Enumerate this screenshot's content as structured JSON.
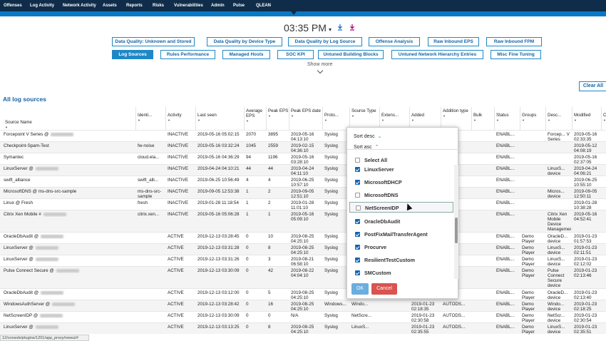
{
  "nav": {
    "items": [
      "Offenses",
      "Log Activity",
      "Network Activity",
      "Assets",
      "Reports",
      "Risks",
      "Vulnerabilities",
      "Admin",
      "Pulse",
      "QLEAN"
    ]
  },
  "clock": {
    "time": "03:35 PM",
    "chevron": "▾"
  },
  "icons": {
    "download_blue": "download-icon",
    "download_pink": "download-icon",
    "dropdown": "chevron-down-icon"
  },
  "tabs": {
    "row1": [
      "Data Quality: Unknown and Stored",
      "Data Quality by Device Type",
      "Data Quality by Log Source",
      "Offense Analysis",
      "Raw Inbound EPS",
      "Raw Inbound FPM"
    ],
    "row2": [
      "Log Sources",
      "Rules Performance",
      "Managed Hosts",
      "SOC KPI",
      "Untuned Building Blocks",
      "Untuned Network Hierarchy Entries",
      "Misc Fine Tuning"
    ],
    "active": "Log Sources",
    "show_more": "Show more"
  },
  "section": {
    "title": "All log sources",
    "clear_all": "Clear All"
  },
  "table": {
    "headers": [
      "Source Name",
      "Identi...",
      "Activity",
      "Last seen",
      "Average EPS",
      "Peak EPS",
      "Peak EPS date",
      "Proto...",
      "Source Type",
      "Extens...",
      "Added",
      "Addition type",
      "Bulk",
      "Status",
      "Groups",
      "Desc...",
      "Modified",
      "C"
    ],
    "rows": [
      {
        "name": "Forcepoint V Series @",
        "id": "",
        "act": "INACTIVE",
        "seen": "2019-05-16 05:02:15",
        "avg": "2070",
        "peak": "3895",
        "pdate": "2019-05-16 04:13:10",
        "proto": "Syslog",
        "status": "ENABL...",
        "groups": "",
        "desc": "Forcep... V Series",
        "mod": "2019-05-16 02:33:35"
      },
      {
        "name": "Checkpoint-Spam-Test",
        "id": "fw-noise",
        "act": "INACTIVE",
        "seen": "2019-05-16 03:32:24",
        "avg": "1045",
        "peak": "2559",
        "pdate": "2019-02-15 04:36:10",
        "proto": "Syslog",
        "status": "ENABL...",
        "groups": "",
        "desc": "",
        "mod": "2019-05-12 04:08:19"
      },
      {
        "name": "Symantec",
        "id": "cloud.ela...",
        "act": "INACTIVE",
        "seen": "2019-05-16 04:36:29",
        "avg": "94",
        "peak": "1196",
        "pdate": "2019-05-16 03:28:10",
        "proto": "Syslog",
        "status": "ENABL...",
        "groups": "",
        "desc": "",
        "mod": "2019-05-16 02:37:05"
      },
      {
        "name": "LinuxServer @",
        "id": "",
        "act": "INACTIVE",
        "seen": "2019-04-24 04:10:21",
        "avg": "44",
        "peak": "44",
        "pdate": "2019-04-24 04:11:10",
        "proto": "Syslog",
        "status": "ENABL...",
        "groups": "",
        "desc": "LinuxS... device",
        "mod": "2019-04-24 04:06:21"
      },
      {
        "name": "swift_alliance",
        "id": "swift_alli...",
        "act": "INACTIVE",
        "seen": "2019-06-25 10:56:49",
        "avg": "4",
        "peak": "4",
        "pdate": "2019-06-25 10:57:10",
        "proto": "Syslog",
        "status": "ENABL...",
        "groups": "",
        "desc": "",
        "mod": "2019-06-25 10:55:10"
      },
      {
        "name": "MicrosoftDNS @ ms-dns-src-sample",
        "id": "ms-dns-src-sample",
        "act": "INACTIVE",
        "seen": "2019-09-05 12:53:38",
        "avg": "1",
        "peak": "2",
        "pdate": "2019-09-05 12:51:10",
        "proto": "Syslog",
        "status": "ENABL...",
        "groups": "",
        "desc": "Micros... device",
        "mod": "2019-09-05 12:50:11"
      },
      {
        "name": "Linux @ Fresh",
        "id": "fresh",
        "act": "INACTIVE",
        "seen": "2019-01-28 11:18:54",
        "avg": "1",
        "peak": "2",
        "pdate": "2019-01-28 11:01:10",
        "proto": "Syslog",
        "status": "ENABL...",
        "groups": "",
        "desc": "",
        "mod": "2019-01-28 10:38:28"
      },
      {
        "name": "Citrix Xen Mobile #",
        "id": "citrix.xen...",
        "act": "INACTIVE",
        "seen": "2019-05-16 05:06:28",
        "avg": "1",
        "peak": "1",
        "pdate": "2019-05-16 05:09:10",
        "proto": "Syslog",
        "status": "ENABL...",
        "groups": "",
        "desc": "Citrix Xen Mobile Device Management",
        "mod": "2019-05-16 04:52:41"
      },
      {
        "name": "OracleDbAudit @",
        "id": "",
        "act": "ACTIVE",
        "seen": "2019-12-13 03:28:45",
        "avg": "0",
        "peak": "10",
        "pdate": "2019-08-25 04:25:10",
        "proto": "Syslog",
        "status": "ENABL...",
        "groups": "Demo Player",
        "desc": "OracleD... device",
        "mod": "2019-01-23 01:57:53"
      },
      {
        "name": "LinuxServer @",
        "id": "",
        "act": "ACTIVE",
        "seen": "2019-12-13 03:31:28",
        "avg": "0",
        "peak": "8",
        "pdate": "2019-08-25 04:25:10",
        "proto": "Syslog",
        "status": "ENABL...",
        "groups": "Demo Player",
        "desc": "LinuxS... device",
        "mod": "2019-01-23 02:11:51"
      },
      {
        "name": "LinuxServer @",
        "id": "",
        "act": "ACTIVE",
        "seen": "2019-12-13 03:31:26",
        "avg": "0",
        "peak": "3",
        "pdate": "2019-08-21 06:58:10",
        "proto": "Syslog",
        "status": "ENABL...",
        "groups": "Demo Player",
        "desc": "LinuxS... device",
        "mod": "2019-01-23 02:12:02"
      },
      {
        "name": "Pulse Connect Secure @",
        "id": "",
        "act": "ACTIVE",
        "seen": "2019-12-13 03:30:09",
        "avg": "0",
        "peak": "42",
        "pdate": "2019-08-22 04:04:10",
        "proto": "Syslog",
        "status": "ENABL...",
        "groups": "Demo Player",
        "desc": "Pulse Connect Secure device",
        "mod": "2019-01-23 02:13:46"
      },
      {
        "name": "OracleDbAudit @",
        "id": "",
        "act": "ACTIVE",
        "seen": "2019-12-13 03:12:00",
        "avg": "0",
        "peak": "5",
        "pdate": "2019-08-25 04:25:10",
        "proto": "Syslog",
        "status": "ENABL...",
        "groups": "Demo Player",
        "desc": "OracleD... device",
        "mod": "2019-01-23 02:13:40"
      },
      {
        "name": "WindowsAuthServer @",
        "id": "",
        "act": "ACTIVE",
        "seen": "2019-12-13 03:28:42",
        "avg": "0",
        "peak": "16",
        "pdate": "2019-08-25 04:25:10",
        "proto": "Windows...",
        "stype": "Windo...",
        "ext": "",
        "added": "2019-01-23 02:18:35",
        "add": "AUTODS...",
        "status": "ENABL...",
        "groups": "Demo Player",
        "desc": "Windo... device",
        "mod": "2019-01-23 02:18:25"
      },
      {
        "name": "NetScreenIDP @",
        "id": "",
        "act": "ACTIVE",
        "seen": "2019-12-13 03:30:09",
        "avg": "0",
        "peak": "0",
        "pdate": "N/A",
        "proto": "Syslog",
        "stype": "NetScre...",
        "ext": "",
        "added": "2019-01-23 02:30:58",
        "add": "AUTODS...",
        "status": "ENABL...",
        "groups": "Demo Player",
        "desc": "NetScr... device",
        "mod": "2019-01-23 02:30:54"
      },
      {
        "name": "LinuxServer @",
        "id": "",
        "act": "ACTIVE",
        "seen": "2019-12-13 03:13:25",
        "avg": "0",
        "peak": "8",
        "pdate": "2019-08-25 04:25:10",
        "proto": "Syslog",
        "stype": "LinuxS...",
        "ext": "",
        "added": "2019-01-23 02:35:55",
        "add": "AUTODS...",
        "status": "ENABL...",
        "groups": "Demo Player",
        "desc": "LinuxS... device",
        "mod": "2019-01-23 02:35:51"
      }
    ]
  },
  "filter_popup": {
    "sort_desc": "Sort desc",
    "sort_asc": "Sort asc",
    "options": [
      {
        "label": "Select All",
        "checked": false
      },
      {
        "label": "LinuxServer",
        "checked": true
      },
      {
        "label": "MicrosoftDHCP",
        "checked": true
      },
      {
        "label": "MicrosoftDNS",
        "checked": false
      },
      {
        "label": "NetScreenIDP",
        "checked": false
      },
      {
        "label": "OracleDbAudit",
        "checked": true
      },
      {
        "label": "PostFixMailTransferAgent",
        "checked": true
      },
      {
        "label": "Procurve",
        "checked": true
      },
      {
        "label": "ResilientTestCustom",
        "checked": true
      },
      {
        "label": "SMCustom",
        "checked": true
      }
    ],
    "ok": "OK",
    "cancel": "Cancel"
  },
  "status_bar": "12/console/plugins/1201/app_proxy/newui/#"
}
